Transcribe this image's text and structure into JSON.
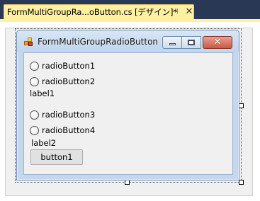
{
  "tab": {
    "title": "FormMultiGroupRa...oButton.cs [デザイン]*",
    "pin_icon": "pin-icon",
    "close_icon": "close-icon",
    "close_glyph": "✕",
    "pin_glyph": "⊣"
  },
  "form": {
    "title": "FormMultiGroupRadioButton",
    "close_glyph": "✕"
  },
  "controls": {
    "radio1": "radioButton1",
    "radio2": "radioButton2",
    "label1": "label1",
    "radio3": "radioButton3",
    "radio4": "radioButton4",
    "label2": "label2",
    "button1": "button1"
  },
  "colors": {
    "tab_background": "#fff1a1",
    "ide_background": "#293955",
    "form_frame": "#c4d7ec",
    "close_button": "#c75a44"
  }
}
